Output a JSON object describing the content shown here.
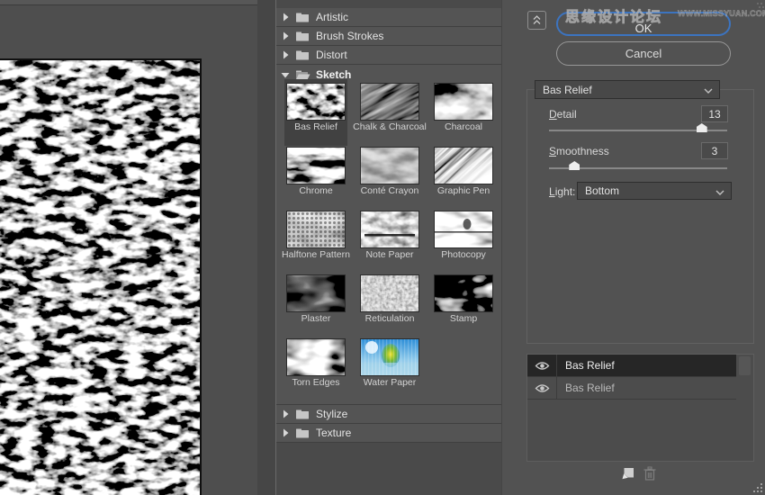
{
  "watermark": {
    "cn": "思缘设计论坛",
    "en": "WWW.MISSYUAN.COM"
  },
  "actions": {
    "ok": "OK",
    "cancel": "Cancel"
  },
  "filter_dropdown": {
    "value": "Bas Relief"
  },
  "sliders": [
    {
      "label": "Detail",
      "value": "13",
      "num": 13,
      "min": 1,
      "max": 15
    },
    {
      "label": "Smoothness",
      "value": "3",
      "num": 3,
      "min": 1,
      "max": 15
    }
  ],
  "light_dropdown": {
    "label": "Light:",
    "value": "Bottom"
  },
  "categories": [
    {
      "label": "Artistic",
      "expanded": false
    },
    {
      "label": "Brush Strokes",
      "expanded": false
    },
    {
      "label": "Distort",
      "expanded": false
    },
    {
      "label": "Sketch",
      "expanded": true
    },
    {
      "label": "Stylize",
      "expanded": false
    },
    {
      "label": "Texture",
      "expanded": false
    }
  ],
  "sketch_filters": [
    {
      "name": "Bas Relief",
      "selected": true
    },
    {
      "name": "Chalk & Charcoal",
      "selected": false
    },
    {
      "name": "Charcoal",
      "selected": false
    },
    {
      "name": "Chrome",
      "selected": false
    },
    {
      "name": "Conté Crayon",
      "selected": false
    },
    {
      "name": "Graphic Pen",
      "selected": false
    },
    {
      "name": "Halftone Pattern",
      "selected": false
    },
    {
      "name": "Note Paper",
      "selected": false
    },
    {
      "name": "Photocopy",
      "selected": false
    },
    {
      "name": "Plaster",
      "selected": false
    },
    {
      "name": "Reticulation",
      "selected": false
    },
    {
      "name": "Stamp",
      "selected": false
    },
    {
      "name": "Torn Edges",
      "selected": false
    },
    {
      "name": "Water Paper",
      "selected": false
    }
  ],
  "effect_layers": [
    {
      "name": "Bas Relief",
      "visible": true,
      "selected": true
    },
    {
      "name": "Bas Relief",
      "visible": true,
      "selected": false
    }
  ]
}
